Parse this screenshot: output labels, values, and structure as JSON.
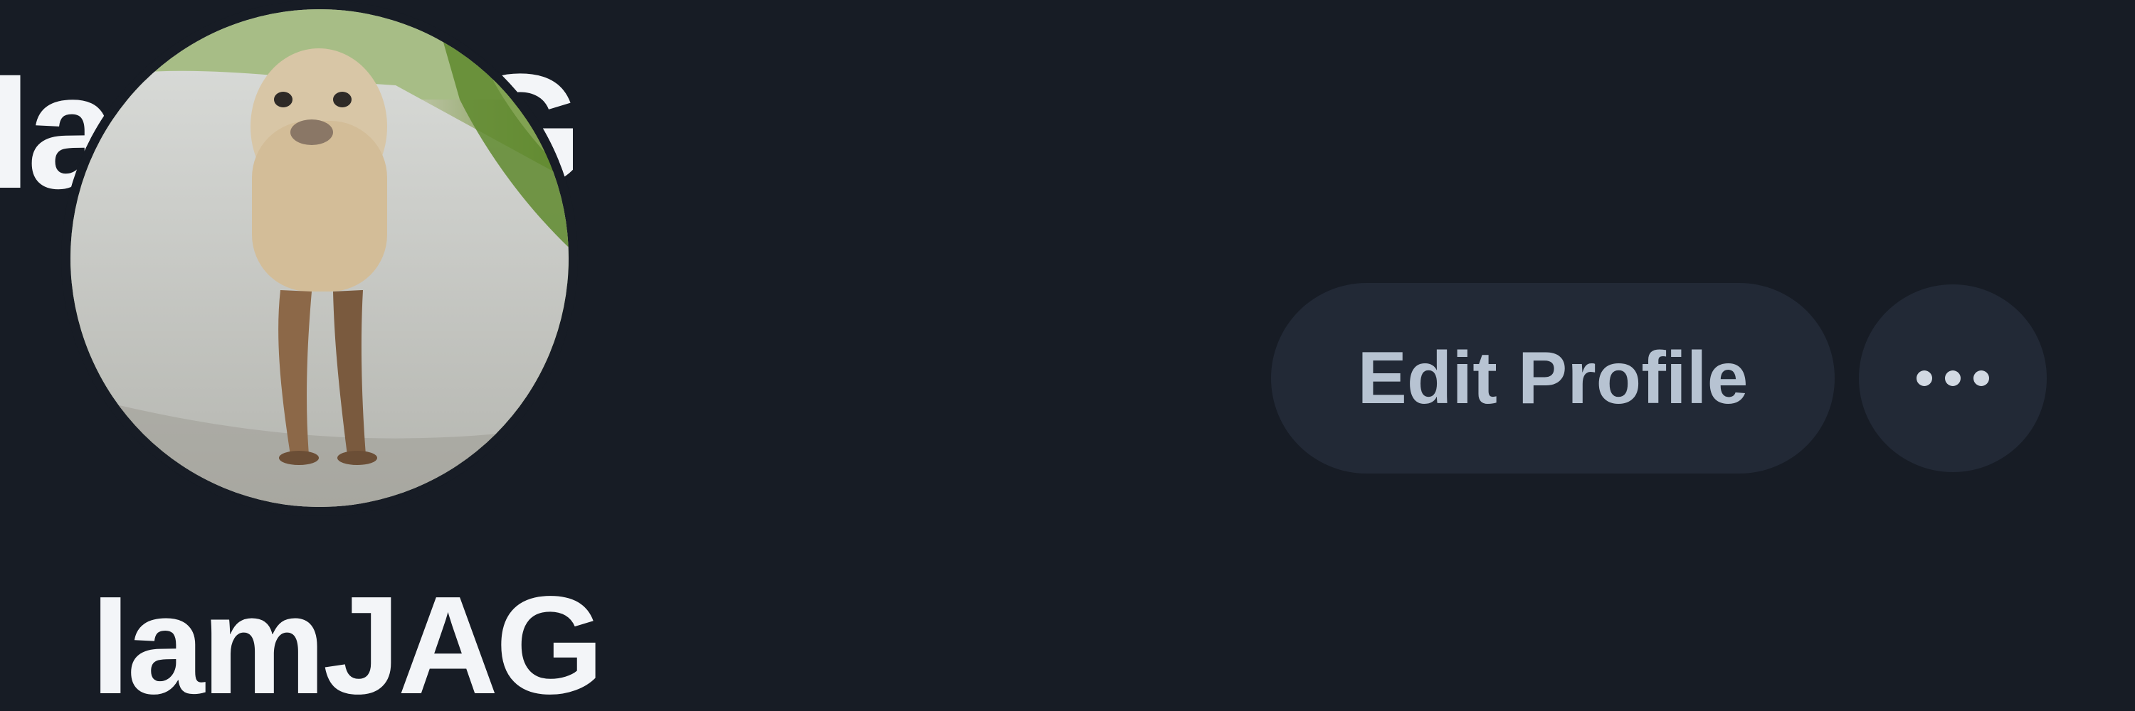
{
  "header": {
    "backdrop_name": "IamJAG"
  },
  "profile": {
    "avatar_icon": "seal-avatar-photo",
    "display_name": "IamJAG"
  },
  "actions": {
    "edit_profile_label": "Edit Profile",
    "more_icon": "ellipsis-icon"
  },
  "colors": {
    "background": "#171c25",
    "button_background": "#222936",
    "button_text": "#b7c3d2",
    "name_text": "#f3f5f8"
  }
}
